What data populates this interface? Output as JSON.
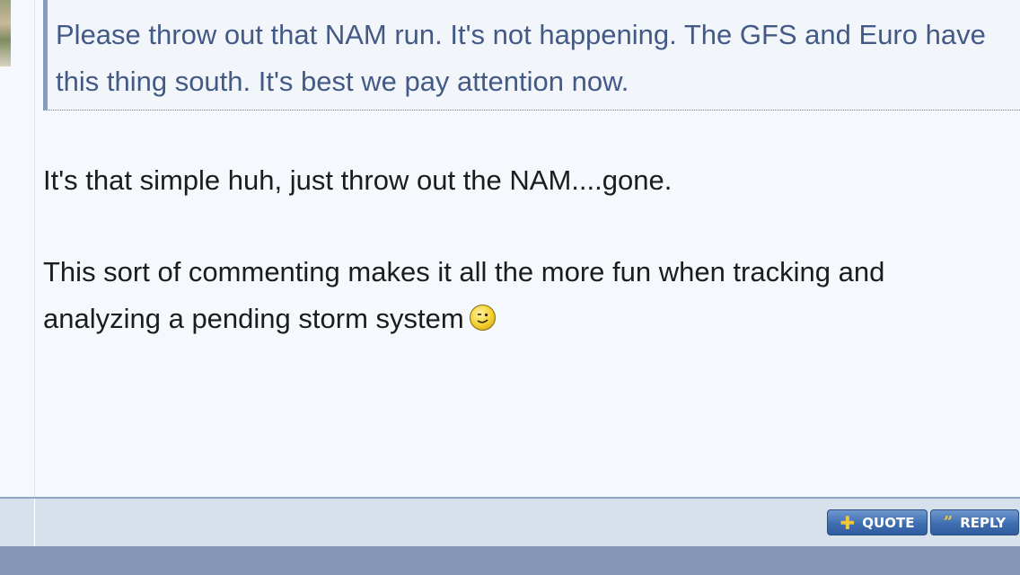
{
  "quote": {
    "text": "Please throw out that NAM run. It's not happening. The GFS and Euro have this thing south. It's best we pay attention now."
  },
  "message": {
    "paragraph1": "It's that simple huh, just throw out the NAM....gone.",
    "paragraph2": "This sort of commenting makes it all the more fun when tracking and analyzing a pending storm system",
    "emoji": "wink-smiley-icon"
  },
  "footer": {
    "quote_label": "QUOTE",
    "reply_label": "REPLY"
  },
  "colors": {
    "quote_text": "#435a87",
    "quote_border": "#8a9ab8",
    "button": "#3f6eb0",
    "button_icon": "#f4c63a",
    "bottom_strip": "#8597b4"
  }
}
